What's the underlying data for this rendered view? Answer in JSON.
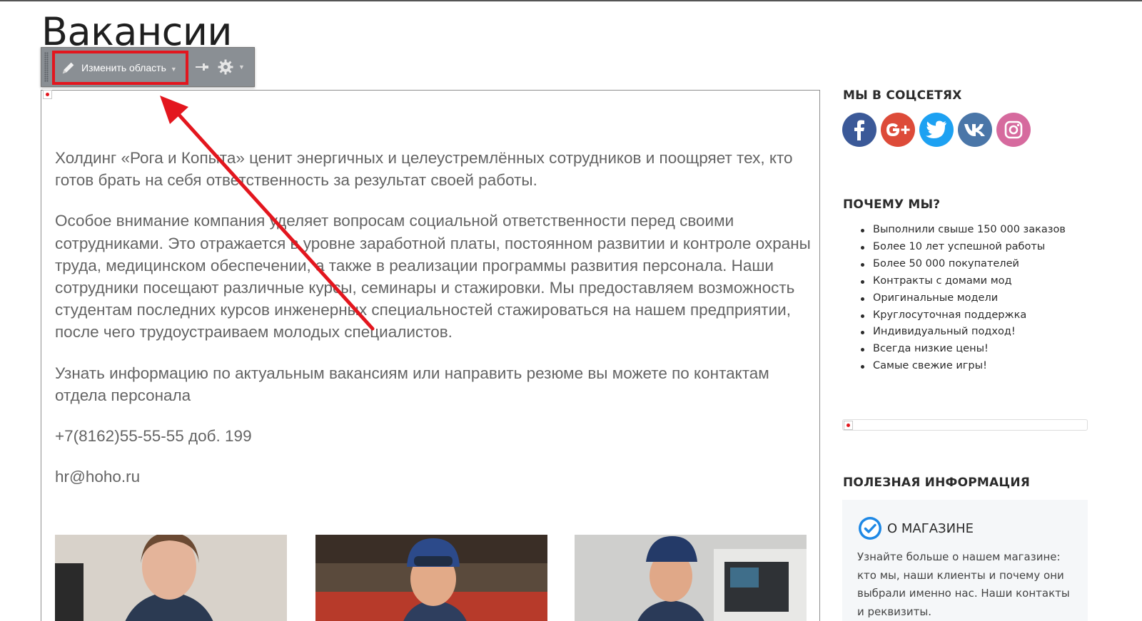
{
  "page": {
    "title": "Вакансии"
  },
  "toolbar": {
    "edit_area_label": "Изменить область",
    "caret": "▼",
    "pin_icon": "pin-icon",
    "gear_icon": "gear-icon"
  },
  "content": {
    "paragraphs": [
      "Холдинг «Рога и Копыта» ценит энергичных и целеустремлённых сотрудников и поощряет тех, кто готов брать на себя ответственность за результат своей работы.",
      "Особое внимание компания уделяет вопросам социальной ответственности перед своими сотрудниками. Это отражается в уровне заработной платы, постоянном развитии и контроле охраны труда, медицинском обеспечении, а также в реализации программы развития персонала. Наши сотрудники посещают различные курсы, семинары и стажировки. Мы предоставляем возможность студентам последних курсов инженерных специальностей стажироваться на нашем предприятии, после чего трудоустраиваем молодых специалистов.",
      "Узнать информацию по актуальным вакансиям или направить резюме вы можете по контактам отдела персонала",
      "+7(8162)55-55-55 доб. 199",
      "hr@hoho.ru"
    ]
  },
  "sidebar": {
    "social_heading": "МЫ В СОЦСЕТЯХ",
    "social": [
      {
        "icon": "facebook-icon",
        "color": "#3b5998"
      },
      {
        "icon": "google-plus-icon",
        "color": "#dd4b39"
      },
      {
        "icon": "twitter-icon",
        "color": "#1da1f2"
      },
      {
        "icon": "vk-icon",
        "color": "#4a76a8"
      },
      {
        "icon": "instagram-icon",
        "color": "#d66a9e"
      }
    ],
    "why_heading": "ПОЧЕМУ МЫ?",
    "why_items": [
      "Выполнили свыше 150 000 заказов",
      "Более 10 лет успешной работы",
      "Более 50 000 покупателей",
      "Контракты с домами мод",
      "Оригинальные модели",
      "Круглосуточная поддержка",
      "Индивидуальный подход!",
      "Всегда низкие цены!",
      "Самые свежие игры!"
    ],
    "useful_heading": "ПОЛЕЗНАЯ ИНФОРМАЦИЯ",
    "about": {
      "title": "О МАГАЗИНЕ",
      "text": "Узнайте больше о нашем магазине: кто мы, наши клиенты и почему они выбрали именно нас. Наши контакты и реквизиты."
    }
  },
  "colors": {
    "highlight_red": "#e3161e",
    "toolbar_bg": "#8a8f94",
    "text_gray": "#646464"
  }
}
